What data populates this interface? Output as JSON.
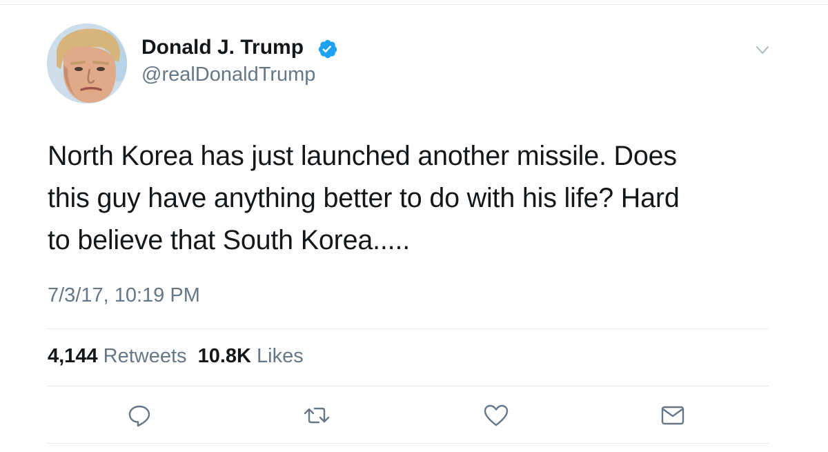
{
  "user": {
    "display_name": "Donald J. Trump",
    "handle": "@realDonaldTrump",
    "verified": true
  },
  "tweet": {
    "lines": [
      "North Korea has just launched another missile. Does",
      "this guy have anything better to do with his life? Hard",
      "to believe that South Korea....."
    ],
    "timestamp": "7/3/17, 10:19 PM"
  },
  "stats": {
    "retweets_count": "4,144",
    "retweets_label": "Retweets",
    "likes_count": "10.8K",
    "likes_label": "Likes"
  },
  "icons": {
    "reply": "reply-icon",
    "retweet": "retweet-icon",
    "like": "heart-icon",
    "dm": "envelope-icon",
    "more": "chevron-down-icon",
    "verified": "verified-badge-icon"
  },
  "colors": {
    "verified_blue": "#1da1f2",
    "secondary_text": "#657786",
    "icon_gray": "#657786"
  }
}
